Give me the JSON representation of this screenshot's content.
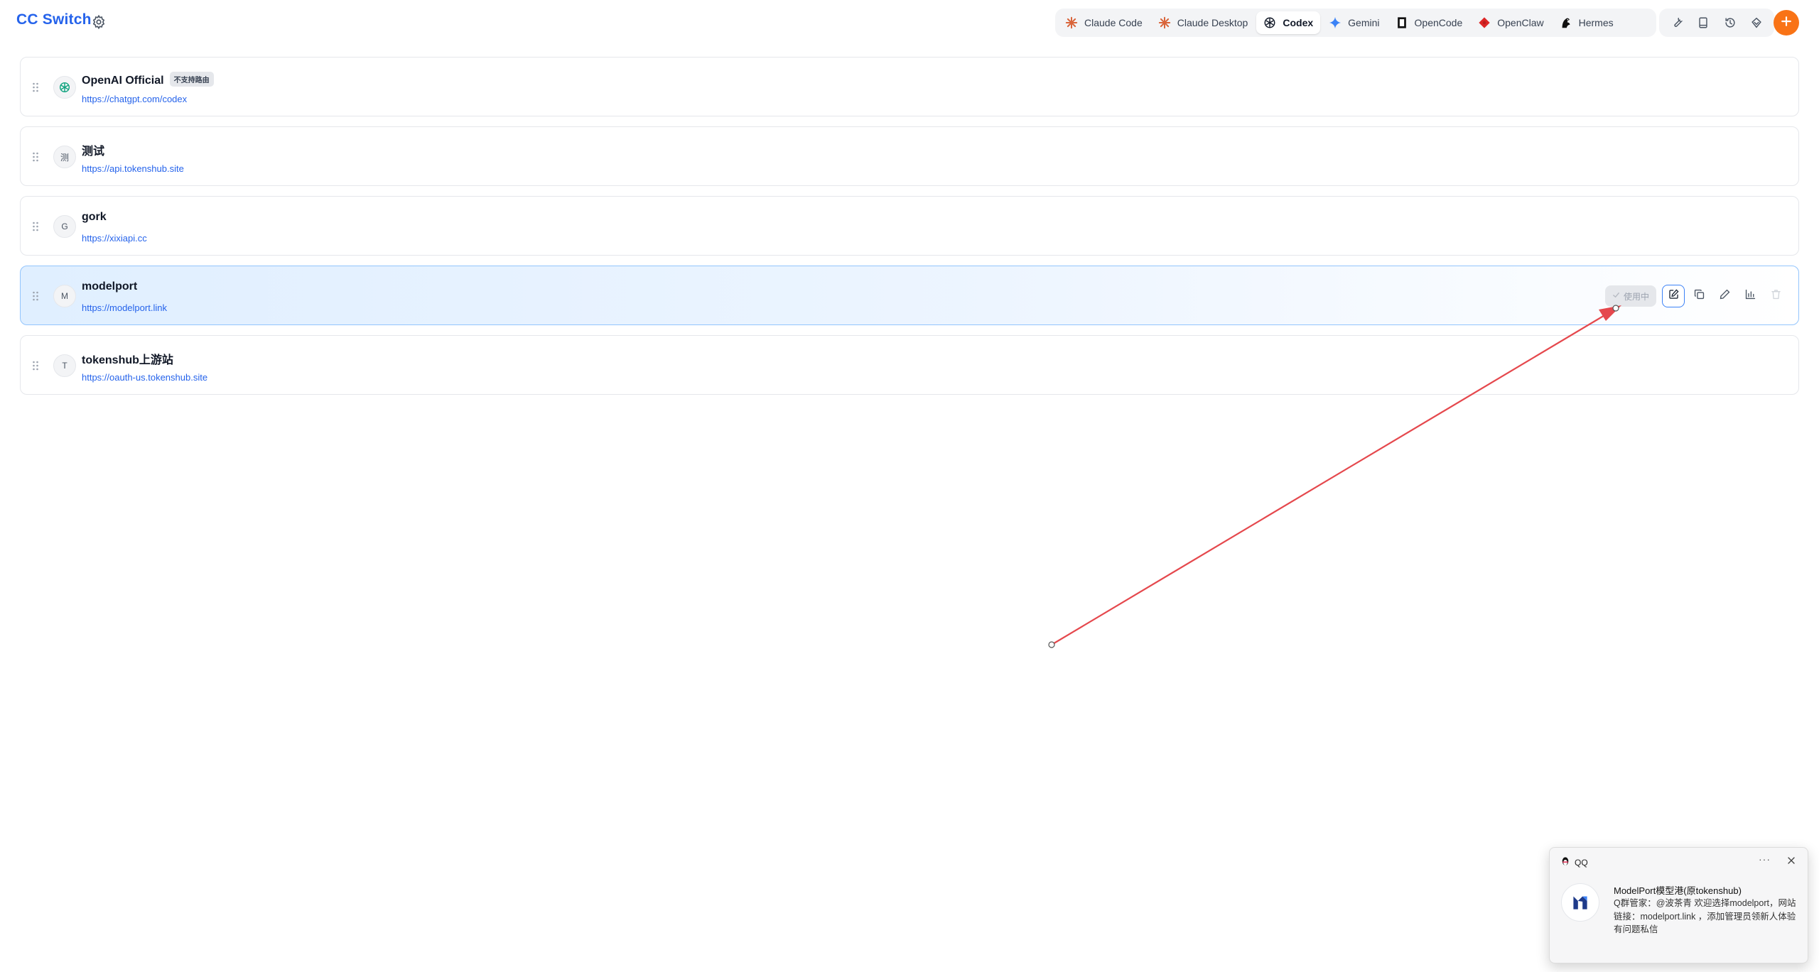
{
  "header": {
    "app_title": "CC Switch",
    "tabs": [
      {
        "label": "Claude Code",
        "icon": "claude-icon",
        "active": false
      },
      {
        "label": "Claude Desktop",
        "icon": "claude-icon",
        "active": false
      },
      {
        "label": "Codex",
        "icon": "openai-icon",
        "active": true
      },
      {
        "label": "Gemini",
        "icon": "gemini-icon",
        "active": false
      },
      {
        "label": "OpenCode",
        "icon": "opencode-icon",
        "active": false
      },
      {
        "label": "OpenClaw",
        "icon": "openclaw-icon",
        "active": false
      },
      {
        "label": "Hermes",
        "icon": "hermes-icon",
        "active": false
      }
    ],
    "tools": [
      "wrench-icon",
      "book-icon",
      "history-icon",
      "radar-icon"
    ],
    "add_icon": "plus-icon"
  },
  "providers": [
    {
      "name": "OpenAI Official",
      "badge": "不支持路由",
      "url": "https://chatgpt.com/codex",
      "avatar": "openai-icon",
      "active": false
    },
    {
      "name": "测试",
      "url": "https://api.tokenshub.site",
      "avatar": "测",
      "active": false
    },
    {
      "name": "gork",
      "url": "https://xixiapi.cc",
      "avatar": "G",
      "active": false
    },
    {
      "name": "modelport",
      "url": "https://modelport.link",
      "avatar": "M",
      "active": true
    },
    {
      "name": "tokenshub上游站",
      "url": "https://oauth-us.tokenshub.site",
      "avatar": "T",
      "active": false
    }
  ],
  "active_actions": {
    "in_use_label": "使用中",
    "buttons": [
      "edit-icon",
      "copy-icon",
      "pencil-icon",
      "chart-icon",
      "trash-icon"
    ]
  },
  "toast": {
    "app": "QQ",
    "more": "···",
    "title": "ModelPort模型港(原tokenshub)",
    "body": "Q群管家：@波茶青 欢迎选择modelport，网站链接：modelport.link ，添加管理员领新人体验有问题私信"
  },
  "colors": {
    "brand": "#2563eb",
    "accent": "#f97316",
    "active_border": "#93c5fd",
    "annotation": "#e5484d"
  }
}
